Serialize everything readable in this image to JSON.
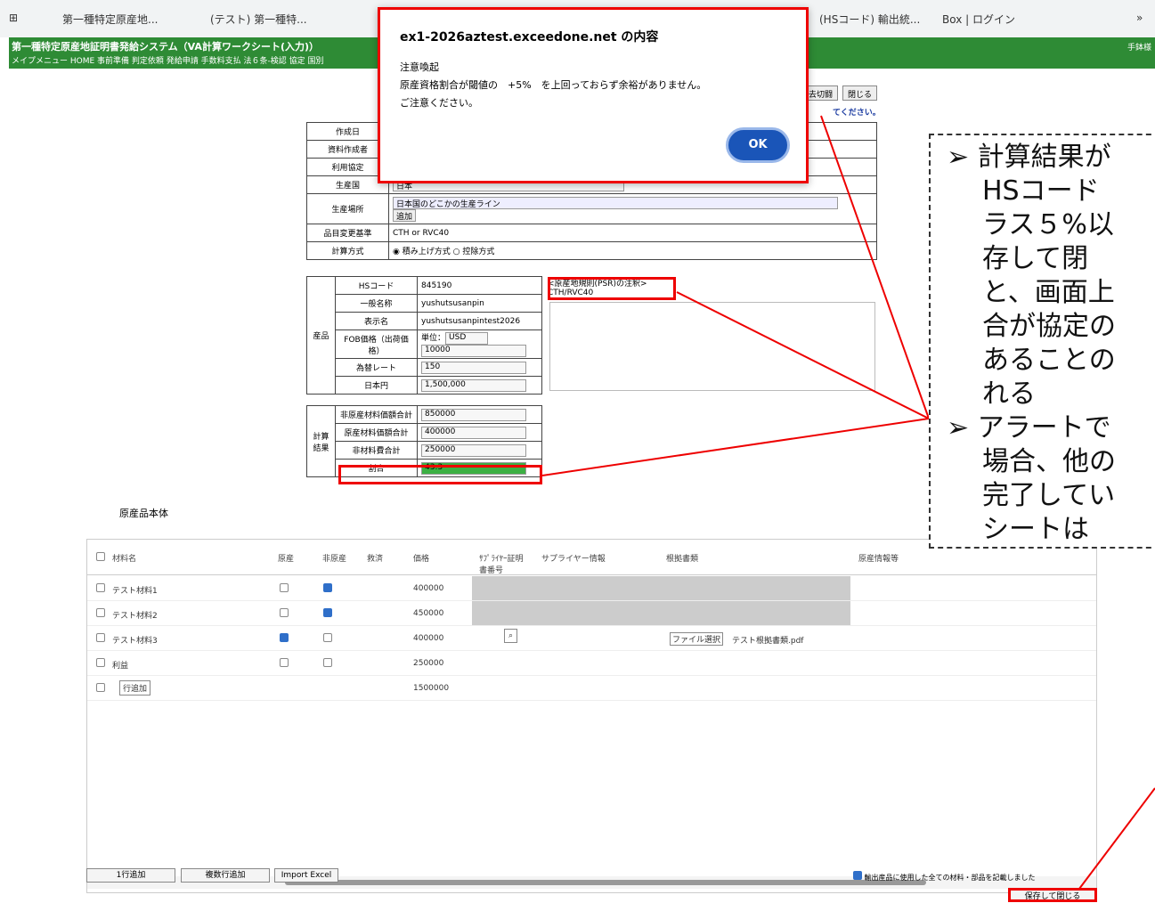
{
  "bookmarks": [
    "第一種特定原産地...",
    "(テスト) 第一種特...",
    "(HSコード) 輸出統...",
    "Box | ログイン",
    "»"
  ],
  "app": {
    "title": "第一種特定原産地証明書発給システム（VA計算ワークシート(入力)）",
    "menu": "メイプメニュー  HOME  事前準備  判定依頼  発給申請  手数料支払  法６条-検認  協定  国別",
    "user": "手鉢様",
    "top_buttons": [
      "去切闘",
      "閉じる"
    ],
    "notice": "てください。"
  },
  "form": {
    "labels": [
      "作成日",
      "資料作成者",
      "利用協定",
      "生産国",
      "生産場所",
      "品目変更基準",
      "計算方式"
    ],
    "production_country": "日本",
    "production_place": "日本国のどこかの生産ライン",
    "add": "追加",
    "criteria": "CTH or RVC40",
    "calc_method": [
      "積み上げ方式",
      "控除方式"
    ]
  },
  "product": {
    "section": "産品",
    "hs_label": "HSコード",
    "hs": "845190",
    "general_label": "一般名称",
    "general": "yushutsusanpin",
    "display_label": "表示名",
    "display": "yushutsusanpintest2026",
    "fob_label": "FOB価格（出荷価格）",
    "unit_label": "単位：",
    "unit": "USD",
    "fob": "10000",
    "rate_label": "為替レート",
    "rate": "150",
    "jpy_label": "日本円",
    "jpy": "1,500,000"
  },
  "psr": {
    "title": "<原産地規則(PSR)の注釈>",
    "value": "CTH/RVC40"
  },
  "calc": {
    "section": "計算結果",
    "rows": [
      {
        "l": "非原産材料価額合計",
        "v": "850000"
      },
      {
        "l": "原産材料価額合計",
        "v": "400000"
      },
      {
        "l": "非材料費合計",
        "v": "250000"
      },
      {
        "l": "割合",
        "v": "43.3"
      }
    ]
  },
  "grid": {
    "title": "原産品本体",
    "headers": [
      "材料名",
      "原産",
      "非原産",
      "救済",
      "価格",
      "ｻﾌﾟﾗｲﾔｰ証明書番号",
      "サプライヤー情報",
      "根拠書類",
      "原産情報等"
    ],
    "rows": [
      {
        "n": "テスト材料1",
        "o": false,
        "no": true,
        "p": "400000"
      },
      {
        "n": "テスト材料2",
        "o": false,
        "no": true,
        "p": "450000"
      },
      {
        "n": "テスト材料3",
        "o": true,
        "no": false,
        "p": "400000",
        "file": "ファイル選択",
        "doc": "テスト根拠書類.pdf"
      },
      {
        "n": "利益",
        "o": false,
        "no": false,
        "p": "250000"
      }
    ],
    "add_row": "行追加",
    "total": "1500000"
  },
  "bottom": {
    "add1": "1行追加",
    "addn": "複数行追加",
    "import": "Import Excel",
    "confirm": "輸出産品に使用した全ての材料・部品を記載しました",
    "save": "保存して閉じる"
  },
  "dialog": {
    "title": "ex1-2026aztest.exceedone.net の内容",
    "l1": "注意喚起",
    "l2": "原産資格割合が閾値の　+5%　を上回っておらず余裕がありません。",
    "l3": "ご注意ください。",
    "ok": "OK"
  },
  "note": [
    "➢  計算結果が",
    "HSコード",
    "ラス５%以",
    "存して閉",
    "と、画面上",
    "合が協定の",
    "あることの",
    "れる",
    "➢  アラートで",
    "場合、他の",
    "完了してい",
    "シートは"
  ],
  "colors": {
    "accent": "#2e8b35",
    "highlight": "#e00000",
    "ratio": "#3cb043"
  }
}
